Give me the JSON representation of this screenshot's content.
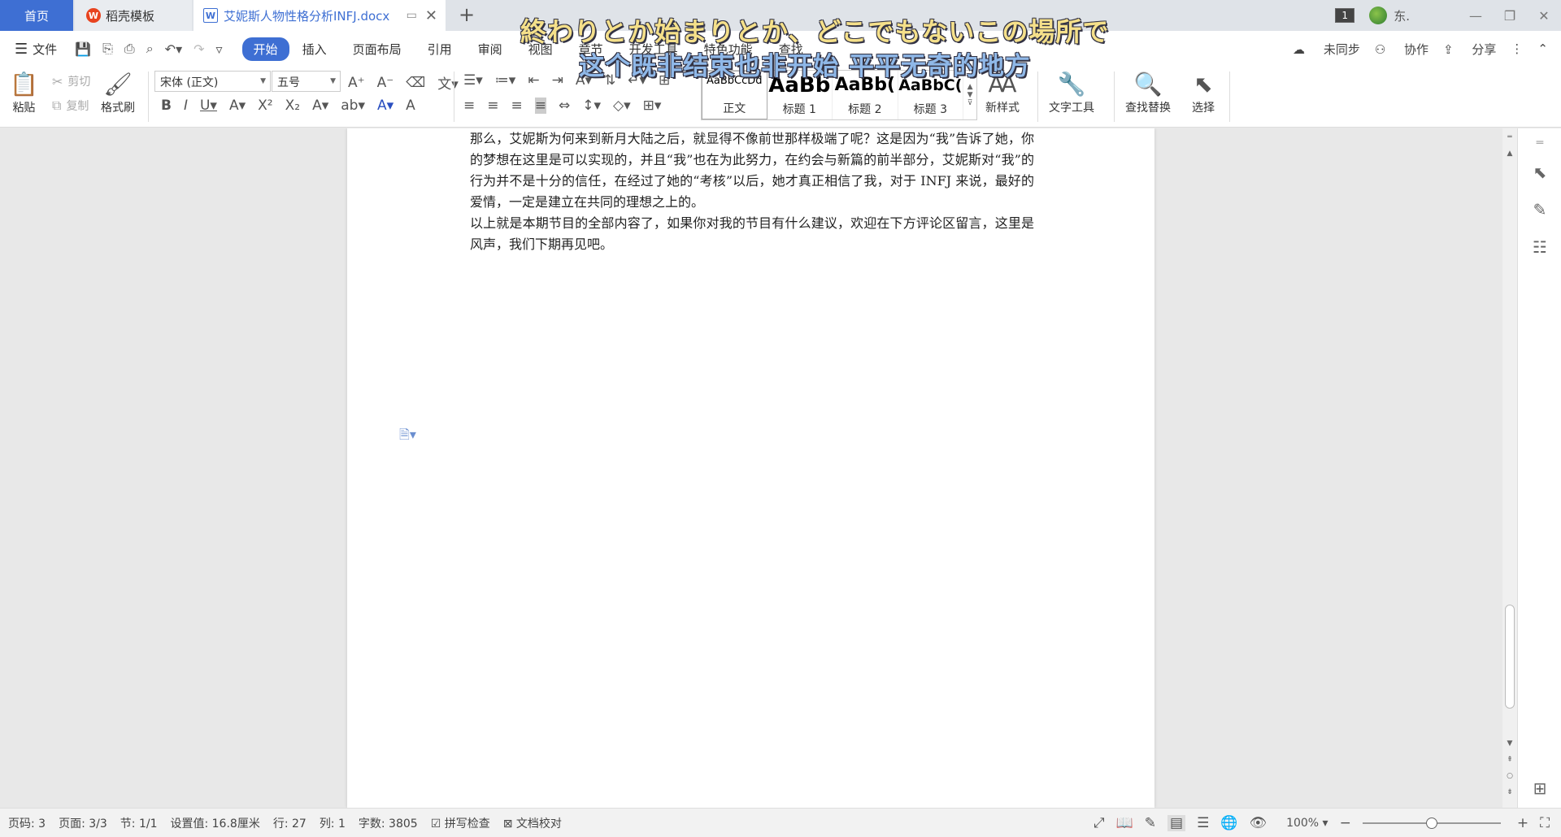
{
  "tabs": {
    "home": "首页",
    "templates": "稻壳模板",
    "document": "艾妮斯人物性格分析INFJ.docx",
    "new_tab": "+"
  },
  "subtitle": {
    "line1": "終わりとか始まりとか、どこでもないこの場所で",
    "line2": "这个既非结束也非开始 平平无奇的地方"
  },
  "titlebar_right": {
    "badge": "1",
    "user": "东."
  },
  "menu": {
    "file": "文件",
    "items": [
      "开始",
      "插入",
      "页面布局",
      "引用",
      "审阅",
      "视图",
      "章节",
      "开发工具",
      "特色功能",
      "查找"
    ],
    "active": "开始",
    "sync": "未同步",
    "collab": "协作",
    "share": "分享"
  },
  "ribbon": {
    "paste": "粘贴",
    "cut": "剪切",
    "copy": "复制",
    "format_painter": "格式刷",
    "font_name": "宋体 (正文)",
    "font_size": "五号",
    "styles": [
      {
        "sample": "AaBbCcDd",
        "name": "正文"
      },
      {
        "sample": "AaBb",
        "name": "标题 1"
      },
      {
        "sample": "AaBb(",
        "name": "标题 2"
      },
      {
        "sample": "AaBbC(",
        "name": "标题 3"
      }
    ],
    "new_style": "新样式",
    "text_tools": "文字工具",
    "find_replace": "查找替换",
    "select": "选择"
  },
  "document": {
    "paragraphs": [
      "那么，艾妮斯为何来到新月大陆之后，就显得不像前世那样极端了呢？这是因为“我”告诉了她，你的梦想在这里是可以实现的，并且“我”也在为此努力，在约会与新篇的前半部分，艾妮斯对“我”的行为并不是十分的信任，在经过了她的“考核”以后，她才真正相信了我，对于 INFJ 来说，最好的爱情，一定是建立在共同的理想之上的。",
      "以上就是本期节目的全部内容了，如果你对我的节目有什么建议，欢迎在下方评论区留言，这里是风声，我们下期再见吧。"
    ]
  },
  "statusbar": {
    "page_code": "页码: 3",
    "pages": "页面: 3/3",
    "section": "节: 1/1",
    "setting": "设置值: 16.8厘米",
    "row": "行: 27",
    "col": "列: 1",
    "word_count": "字数: 3805",
    "spell_check": "拼写检查",
    "doc_proof": "文档校对",
    "zoom": "100%",
    "zoom_level": 0.5
  }
}
